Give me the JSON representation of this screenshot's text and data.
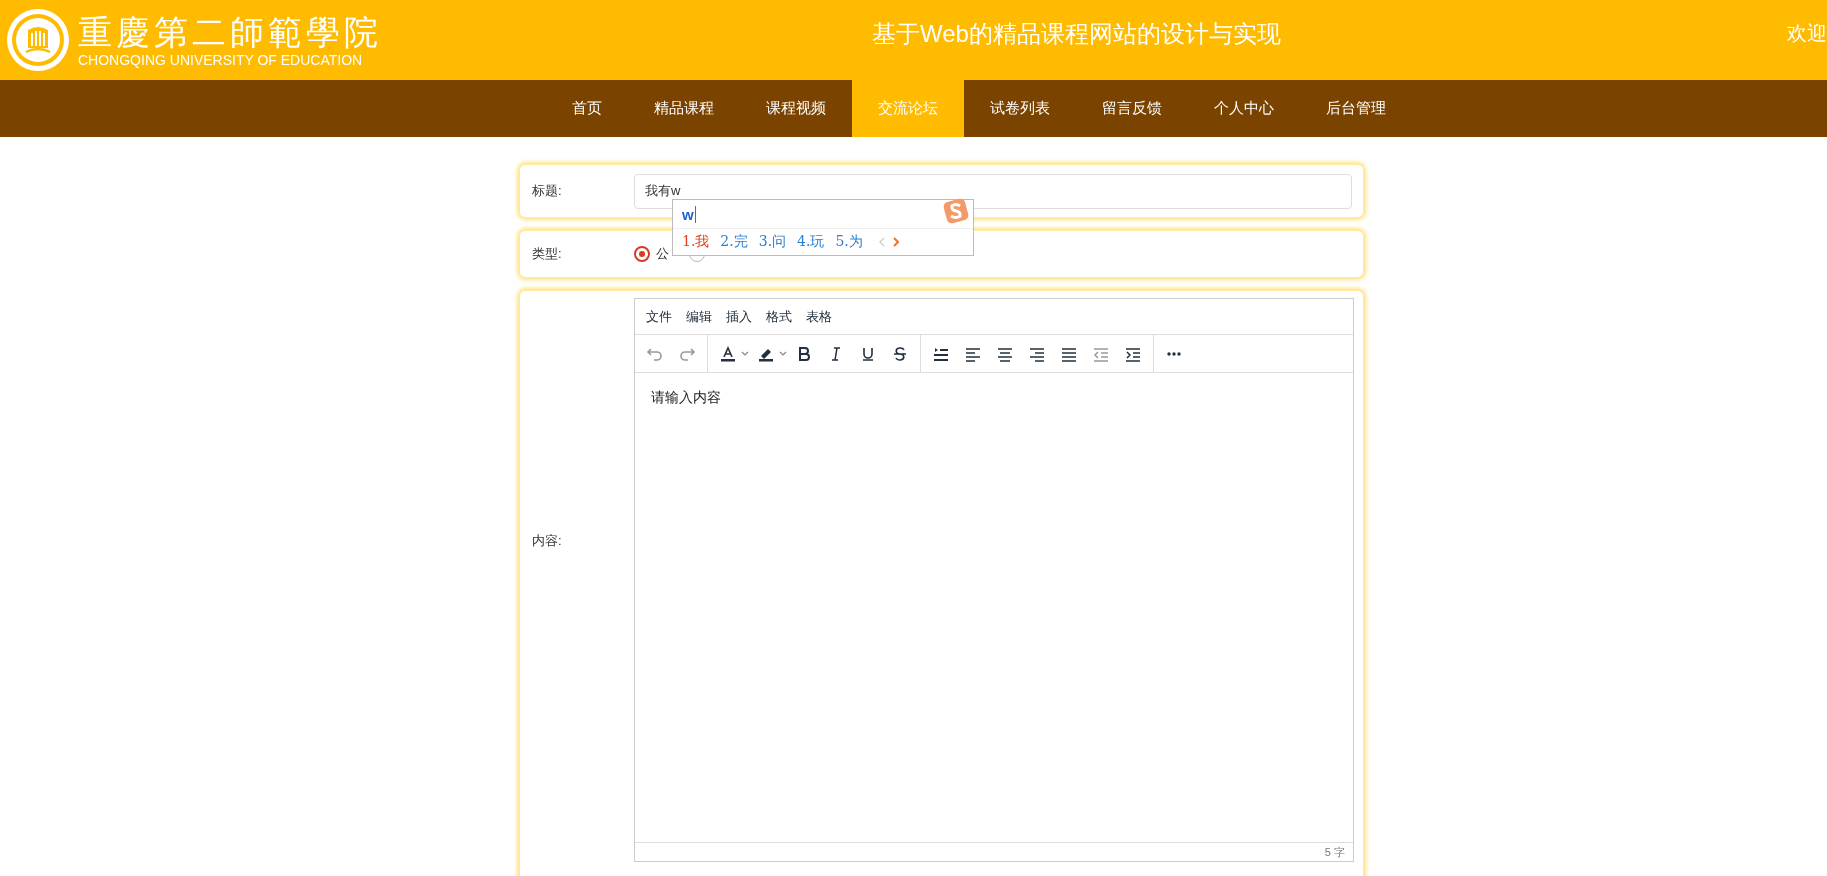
{
  "header": {
    "logo_title": "重慶第二師範學院",
    "logo_subtitle": "CHONGQING UNIVERSITY OF EDUCATION",
    "site_title": "基于Web的精品课程网站的设计与实现",
    "welcome": "欢迎"
  },
  "nav": [
    {
      "label": "首页",
      "selected": false
    },
    {
      "label": "精品课程",
      "selected": false
    },
    {
      "label": "课程视频",
      "selected": false
    },
    {
      "label": "交流论坛",
      "selected": true
    },
    {
      "label": "试卷列表",
      "selected": false
    },
    {
      "label": "留言反馈",
      "selected": false
    },
    {
      "label": "个人中心",
      "selected": false
    },
    {
      "label": "后台管理",
      "selected": false
    }
  ],
  "form": {
    "title_label": "标题:",
    "title_value": "我有w",
    "type_label": "类型:",
    "type_options": [
      {
        "label": "公",
        "selected": true
      },
      {
        "selected": false
      }
    ],
    "content_label": "内容:",
    "editor": {
      "menu": [
        "文件",
        "编辑",
        "插入",
        "格式",
        "表格"
      ],
      "toolbar": [
        {
          "kind": "undo",
          "disabled": true
        },
        {
          "kind": "redo",
          "disabled": true
        },
        {
          "kind": "separator"
        },
        {
          "kind": "text-color",
          "disabled": false
        },
        {
          "kind": "caret"
        },
        {
          "kind": "highlight",
          "disabled": false
        },
        {
          "kind": "caret"
        },
        {
          "kind": "bold",
          "disabled": false
        },
        {
          "kind": "italic",
          "disabled": false
        },
        {
          "kind": "underline",
          "disabled": false
        },
        {
          "kind": "strike",
          "disabled": false
        },
        {
          "kind": "separator"
        },
        {
          "kind": "line-height",
          "disabled": false
        },
        {
          "kind": "align-left",
          "disabled": false
        },
        {
          "kind": "align-center",
          "disabled": false
        },
        {
          "kind": "align-right",
          "disabled": false
        },
        {
          "kind": "justify",
          "disabled": false
        },
        {
          "kind": "outdent",
          "disabled": true
        },
        {
          "kind": "indent",
          "disabled": false
        },
        {
          "kind": "separator"
        },
        {
          "kind": "more",
          "disabled": false
        }
      ],
      "text": "请输入内容",
      "word_count": "5 字"
    }
  },
  "ime": {
    "composition": "w",
    "candidates": [
      {
        "label": "1.我",
        "selected": true
      },
      {
        "label": "2.完",
        "selected": false
      },
      {
        "label": "3.问",
        "selected": false
      },
      {
        "label": "4.玩",
        "selected": false
      },
      {
        "label": "5.为",
        "selected": false
      }
    ]
  }
}
